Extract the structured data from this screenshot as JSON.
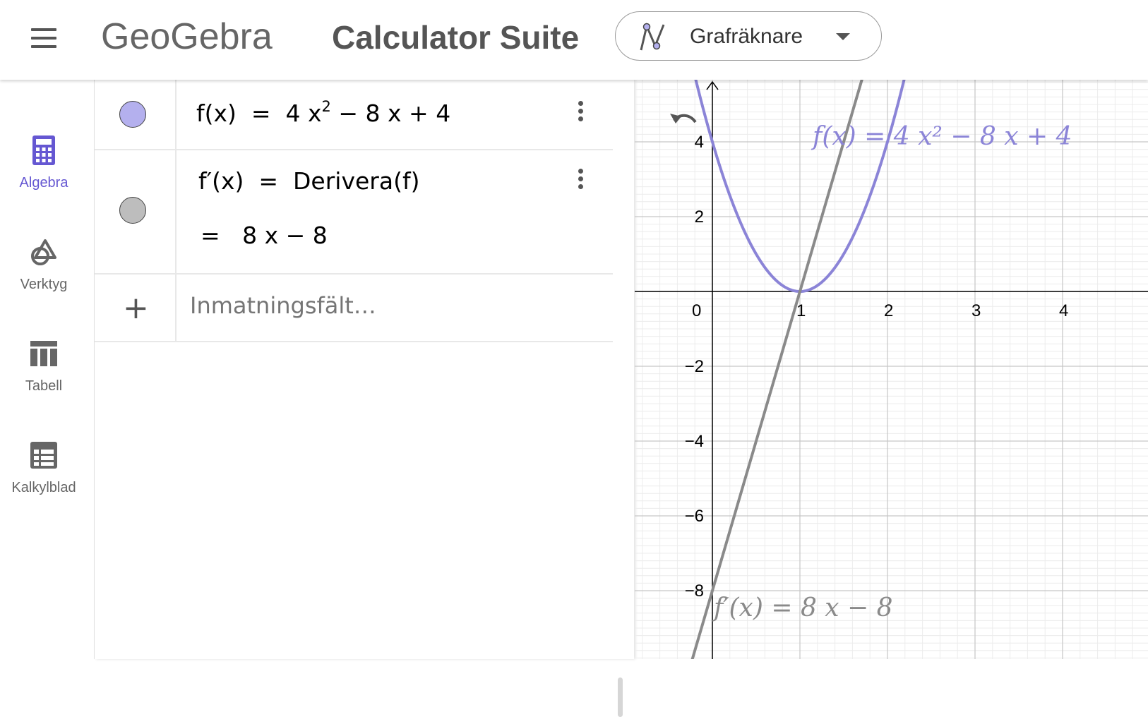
{
  "header": {
    "logo": "GeoGebra",
    "title": "Calculator Suite",
    "app_switcher": {
      "label": "Grafräknare"
    }
  },
  "sidenav": {
    "items": [
      {
        "label": "Algebra",
        "icon": "calculator-icon",
        "active": true
      },
      {
        "label": "Verktyg",
        "icon": "tools-shapes-icon",
        "active": false
      },
      {
        "label": "Tabell",
        "icon": "table-icon",
        "active": false
      },
      {
        "label": "Kalkylblad",
        "icon": "spreadsheet-icon",
        "active": false
      }
    ]
  },
  "algebra": {
    "rows": [
      {
        "name": "f",
        "lhs": "f(x)",
        "eq": "=",
        "expr_parts": [
          "4 x",
          "2",
          " − 8 x + 4"
        ],
        "color": "#b4b0ee"
      },
      {
        "name": "f'",
        "lhs": "f′(x)",
        "eq": "=",
        "definition": "Derivera(f)",
        "value_line": "=   8 x − 8",
        "color": "#bdbdbd"
      }
    ],
    "input_placeholder": "Inmatningsfält…"
  },
  "graph": {
    "x_ticks": [
      "0",
      "1",
      "2",
      "3",
      "4"
    ],
    "y_ticks": [
      "4",
      "2",
      "−2",
      "−4",
      "−6",
      "−8"
    ],
    "f_label": "f(x)  =  4 x² − 8 x + 4",
    "fprime_label": "f′(x)  =  8 x − 8",
    "f_color": "#8b84d7",
    "fprime_color": "#8a8a8a"
  }
}
